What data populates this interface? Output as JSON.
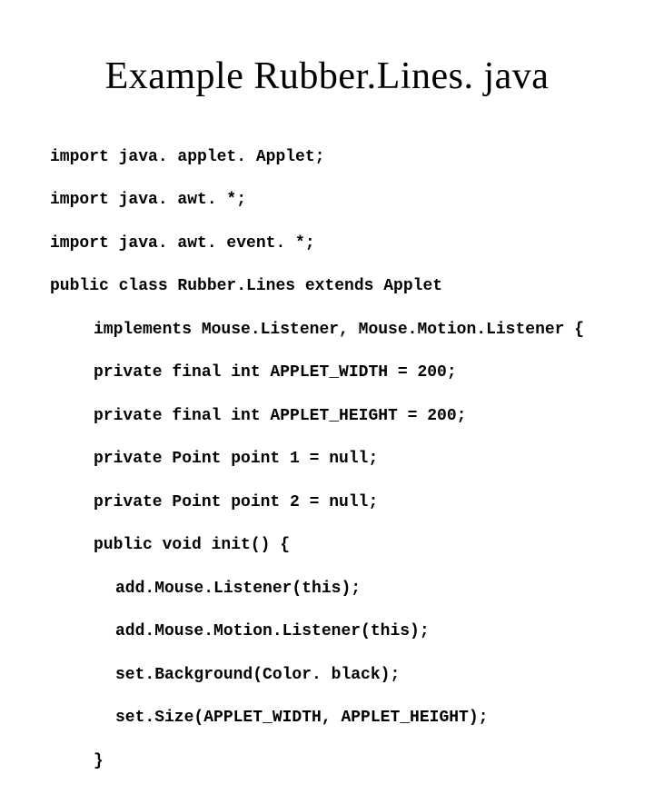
{
  "title": "Example Rubber.Lines. java",
  "code": {
    "l1": "import java. applet. Applet;",
    "l2": "import java. awt. *;",
    "l3": "import java. awt. event. *;",
    "l4": "public class Rubber.Lines extends Applet",
    "l5": "implements Mouse.Listener, Mouse.Motion.Listener {",
    "l6": "private final int APPLET_WIDTH = 200;",
    "l7": "private final int APPLET_HEIGHT = 200;",
    "l8": "private Point point 1 = null;",
    "l9": "private Point point 2 = null;",
    "l10": "public void init() {",
    "l11": "add.Mouse.Listener(this);",
    "l12": "add.Mouse.Motion.Listener(this);",
    "l13": "set.Background(Color. black);",
    "l14": "set.Size(APPLET_WIDTH, APPLET_HEIGHT);",
    "l15": "}"
  }
}
